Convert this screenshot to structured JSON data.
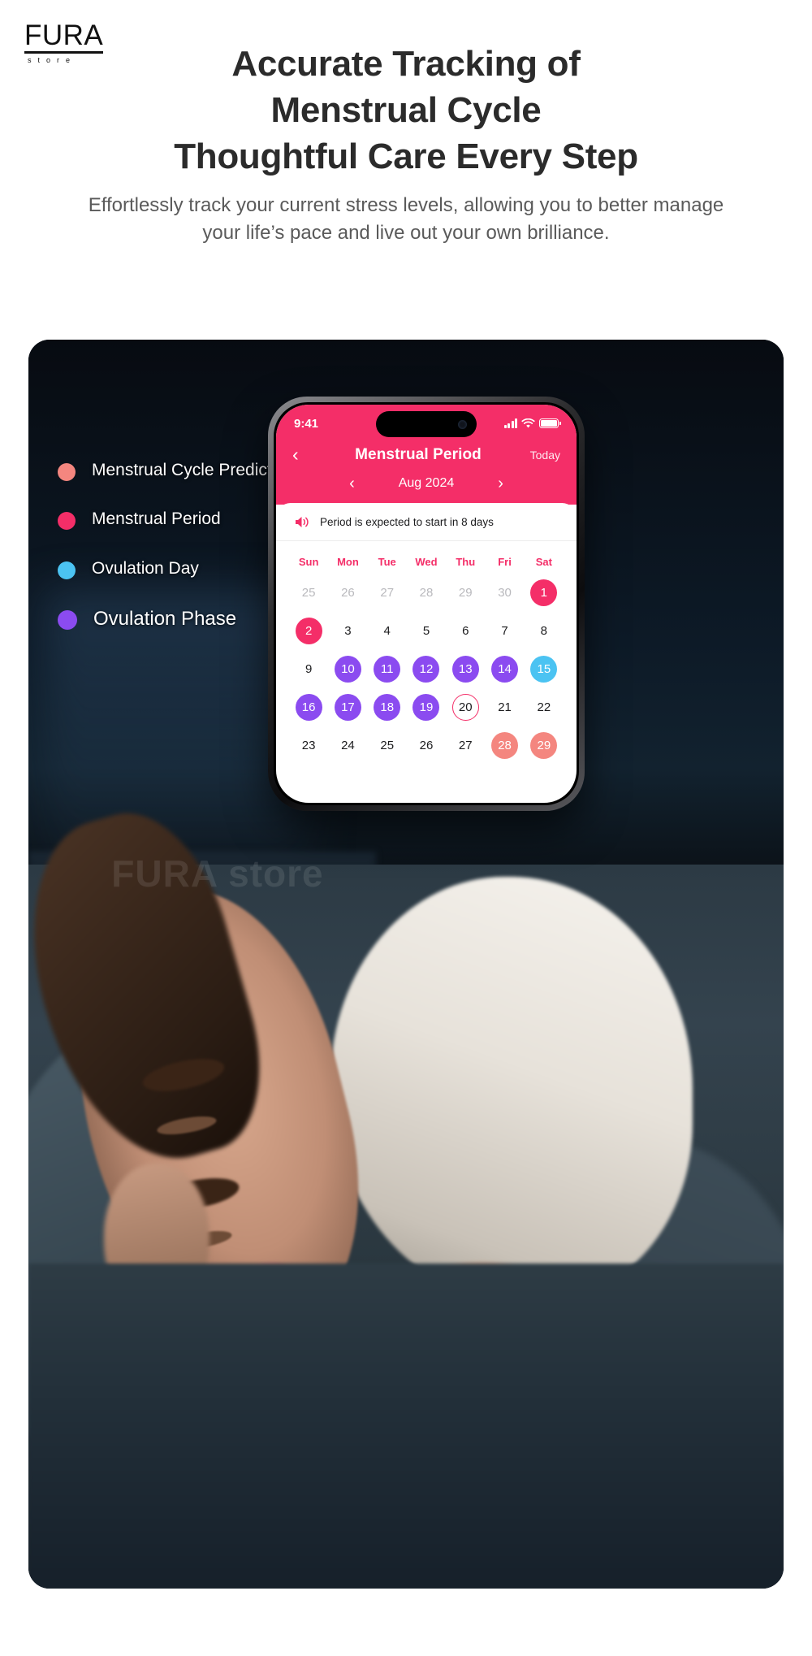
{
  "brand": {
    "name": "FURA",
    "tagline": "store"
  },
  "headline": {
    "line1": "Accurate Tracking of",
    "line2": "Menstrual Cycle",
    "line3": "Thoughtful Care Every Step"
  },
  "subheadline": "Effortlessly track your current stress levels, allowing you to better manage your life’s pace and live out your own brilliance.",
  "hero": {
    "watermark": "FURA store",
    "legend": [
      {
        "label": "Menstrual Cycle Prediction",
        "color": "#f4867f",
        "name": "menstrual-cycle-prediction"
      },
      {
        "label": "Menstrual Period",
        "color": "#f42e68",
        "name": "menstrual-period"
      },
      {
        "label": "Ovulation Day",
        "color": "#4bc3f2",
        "name": "ovulation-day"
      },
      {
        "label": "Ovulation Phase",
        "color": "#8b4bf0",
        "name": "ovulation-phase"
      }
    ]
  },
  "phone": {
    "status": {
      "time": "9:41",
      "signal_icon": "cellular-bars-icon",
      "wifi_icon": "wifi-icon",
      "battery_icon": "battery-full-icon"
    },
    "navbar": {
      "back_icon": "chevron-left-icon",
      "title": "Menstrual Period",
      "today_label": "Today"
    },
    "month_selector": {
      "prev_icon": "chevron-left-icon",
      "label": "Aug 2024",
      "next_icon": "chevron-right-icon"
    },
    "notice": {
      "icon": "speaker-icon",
      "text": "Period is expected to start in 8 days"
    },
    "calendar": {
      "weekdays": [
        "Sun",
        "Mon",
        "Tue",
        "Wed",
        "Thu",
        "Fri",
        "Sat"
      ],
      "weeks": [
        [
          {
            "day": "25",
            "state": "muted"
          },
          {
            "day": "26",
            "state": "muted"
          },
          {
            "day": "27",
            "state": "muted"
          },
          {
            "day": "28",
            "state": "muted"
          },
          {
            "day": "29",
            "state": "muted"
          },
          {
            "day": "30",
            "state": "muted"
          },
          {
            "day": "1",
            "state": "period"
          }
        ],
        [
          {
            "day": "2",
            "state": "period"
          },
          {
            "day": "3",
            "state": "plain"
          },
          {
            "day": "4",
            "state": "plain"
          },
          {
            "day": "5",
            "state": "plain"
          },
          {
            "day": "6",
            "state": "plain"
          },
          {
            "day": "7",
            "state": "plain"
          },
          {
            "day": "8",
            "state": "plain"
          }
        ],
        [
          {
            "day": "9",
            "state": "plain"
          },
          {
            "day": "10",
            "state": "phase"
          },
          {
            "day": "11",
            "state": "phase"
          },
          {
            "day": "12",
            "state": "phase"
          },
          {
            "day": "13",
            "state": "phase"
          },
          {
            "day": "14",
            "state": "phase"
          },
          {
            "day": "15",
            "state": "ovulation"
          }
        ],
        [
          {
            "day": "16",
            "state": "phase"
          },
          {
            "day": "17",
            "state": "phase"
          },
          {
            "day": "18",
            "state": "phase"
          },
          {
            "day": "19",
            "state": "phase"
          },
          {
            "day": "20",
            "state": "today"
          },
          {
            "day": "21",
            "state": "plain"
          },
          {
            "day": "22",
            "state": "plain"
          }
        ],
        [
          {
            "day": "23",
            "state": "plain"
          },
          {
            "day": "24",
            "state": "plain"
          },
          {
            "day": "25",
            "state": "plain"
          },
          {
            "day": "26",
            "state": "plain"
          },
          {
            "day": "27",
            "state": "plain"
          },
          {
            "day": "28",
            "state": "prediction"
          },
          {
            "day": "29",
            "state": "prediction"
          }
        ]
      ]
    }
  },
  "colors": {
    "brand_pink": "#f42e68",
    "prediction": "#f4867f",
    "ovulation_day": "#4bc3f2",
    "ovulation_phase": "#8b4bf0",
    "headline_text": "#2b2b2b",
    "sub_text": "#5a5a5a"
  }
}
